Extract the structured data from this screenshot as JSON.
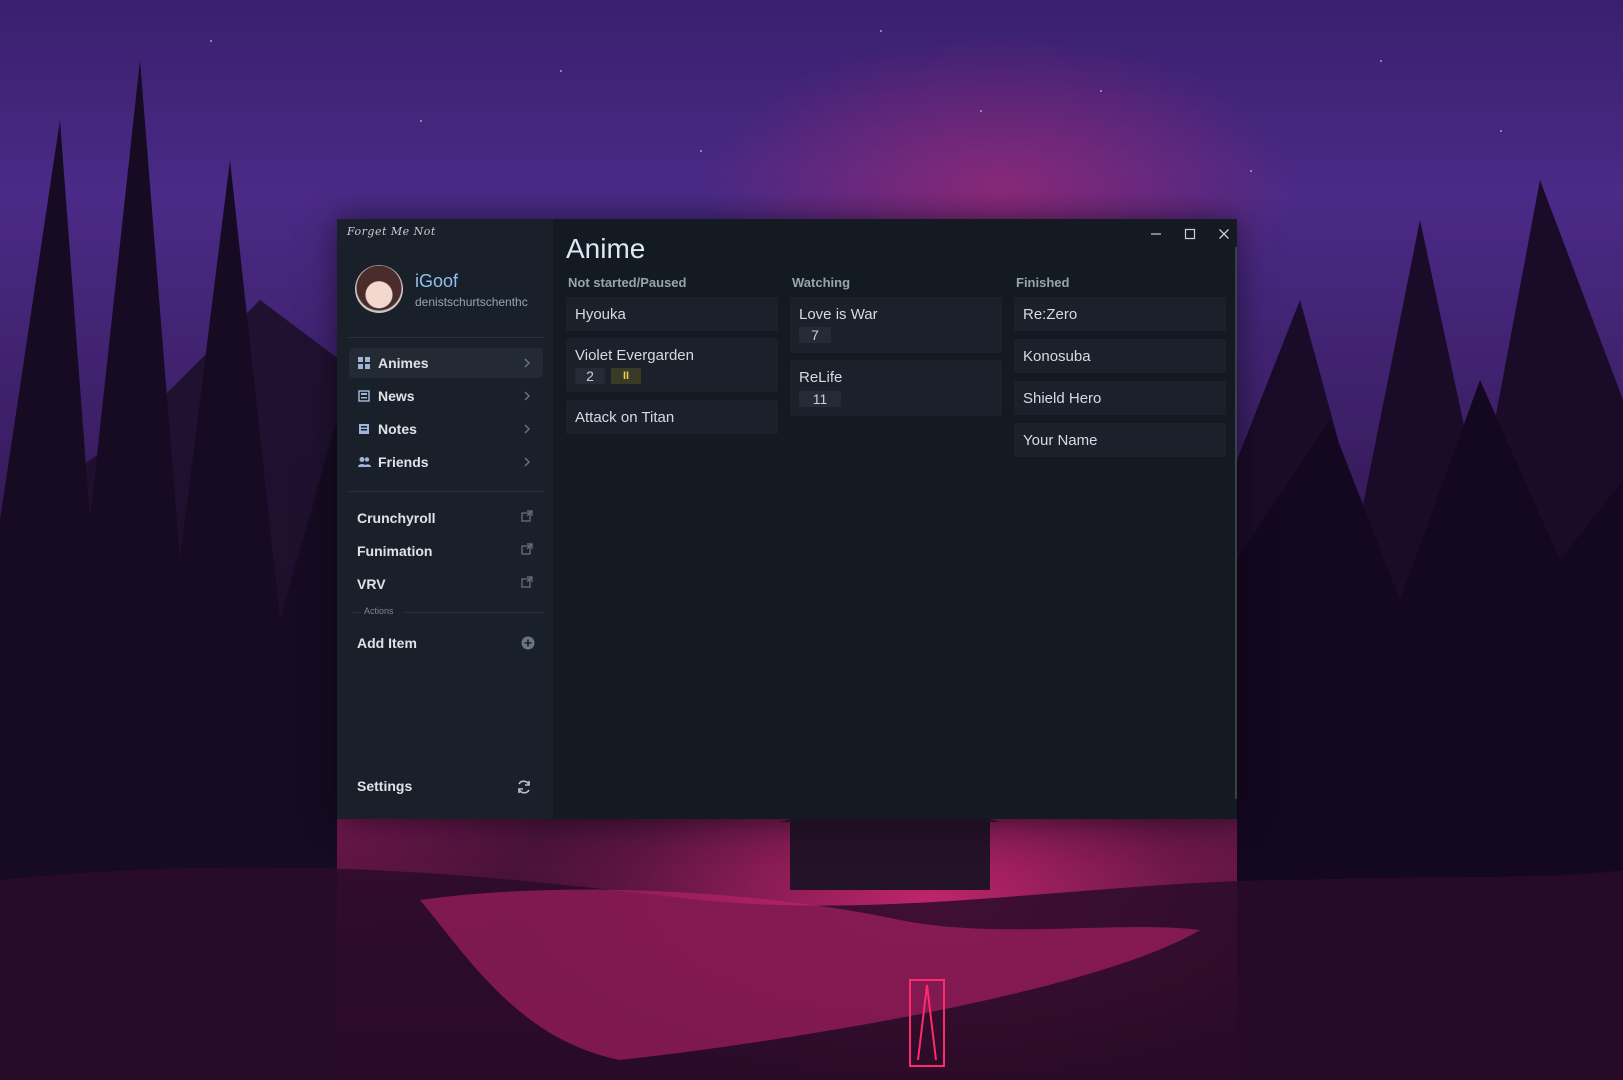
{
  "app": {
    "title": "Forget Me Not"
  },
  "user": {
    "name": "iGoof",
    "email": "denistschurtschenthc"
  },
  "nav": {
    "items": [
      {
        "label": "Animes",
        "icon": "grid-icon"
      },
      {
        "label": "News",
        "icon": "newspaper-icon"
      },
      {
        "label": "Notes",
        "icon": "note-icon"
      },
      {
        "label": "Friends",
        "icon": "friends-icon"
      }
    ]
  },
  "links": {
    "items": [
      {
        "label": "Crunchyroll",
        "icon": "external-link-icon"
      },
      {
        "label": "Funimation",
        "icon": "external-link-icon"
      },
      {
        "label": "VRV",
        "icon": "external-link-icon"
      }
    ]
  },
  "actions": {
    "header": "Actions",
    "add_item": "Add Item"
  },
  "settings": {
    "label": "Settings"
  },
  "main": {
    "title": "Anime",
    "columns": [
      {
        "header": "Not started/Paused",
        "cards": [
          {
            "title": "Hyouka"
          },
          {
            "title": "Violet Evergarden",
            "episode": "2",
            "paused": "II"
          },
          {
            "title": "Attack on Titan"
          }
        ]
      },
      {
        "header": "Watching",
        "cards": [
          {
            "title": "Love is War",
            "episode": "7"
          },
          {
            "title": "ReLife",
            "episode": "11"
          }
        ]
      },
      {
        "header": "Finished",
        "cards": [
          {
            "title": "Re:Zero"
          },
          {
            "title": "Konosuba"
          },
          {
            "title": "Shield Hero"
          },
          {
            "title": "Your Name"
          }
        ]
      }
    ]
  },
  "colors": {
    "window_bg": "#141a22",
    "sidebar_bg": "#1a2029",
    "card_bg": "#1b212a",
    "username": "#8fc0f0",
    "paused_badge": "#e2cf54"
  }
}
